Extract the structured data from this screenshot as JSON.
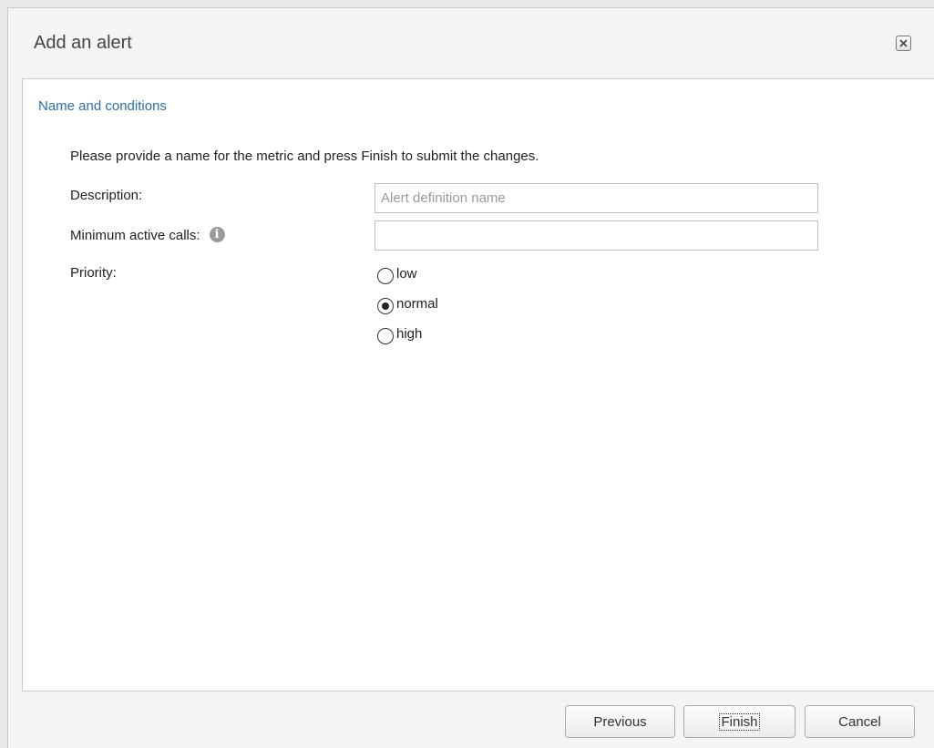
{
  "dialog": {
    "title": "Add an alert",
    "close_icon": "close-icon"
  },
  "section": {
    "title": "Name and conditions",
    "instruction": "Please provide a name for the metric and press Finish to submit the changes."
  },
  "form": {
    "description": {
      "label": "Description:",
      "value": "",
      "placeholder": "Alert definition name"
    },
    "min_active_calls": {
      "label": "Minimum active calls:",
      "value": "",
      "info_icon": "info-icon",
      "info_glyph": "i"
    },
    "priority": {
      "label": "Priority:",
      "options": [
        "low",
        "normal",
        "high"
      ],
      "selected": "normal"
    }
  },
  "footer": {
    "previous_label": "Previous",
    "finish_label": "Finish",
    "cancel_label": "Cancel"
  }
}
